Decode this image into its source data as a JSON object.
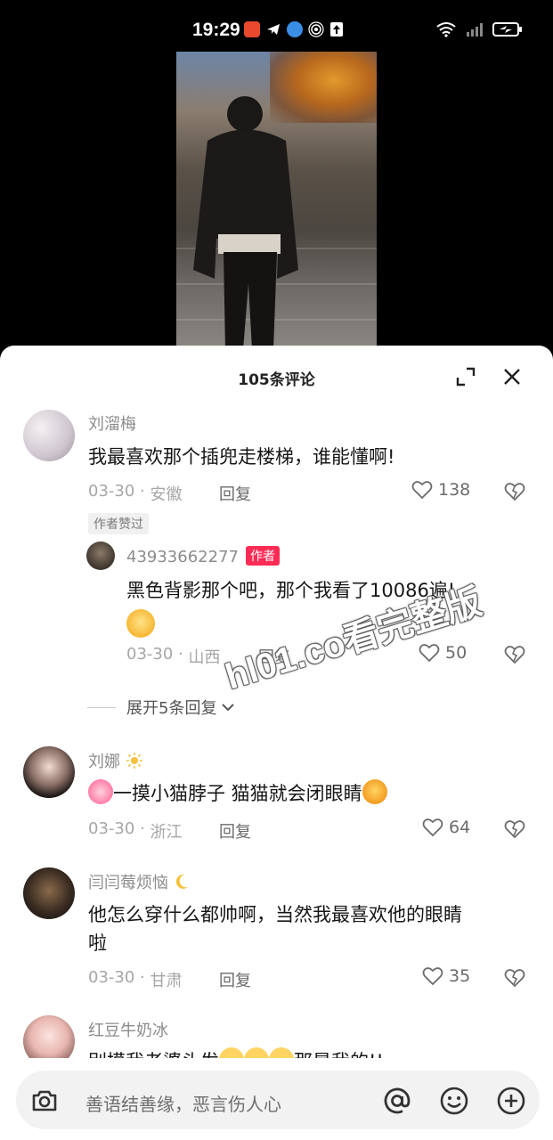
{
  "status_bar": {
    "time": "19:29"
  },
  "sheet": {
    "title": "105条评论"
  },
  "comments": [
    {
      "name": "刘溜梅",
      "text": "我最喜欢那个插兜走楼梯，谁能懂啊!",
      "date": "03-30",
      "location": "安徽",
      "reply_label": "回复",
      "likes": "138",
      "tag": "作者赞过"
    },
    {
      "name": "43933662277",
      "badge": "作者",
      "text": "黑色背影那个吧，那个我看了10086遍!",
      "date": "03-30",
      "location": "山西",
      "reply_label": "回复",
      "likes": "50"
    },
    {
      "name": "刘娜",
      "text": "一摸小猫脖子 猫猫就会闭眼睛",
      "date": "03-30",
      "location": "浙江",
      "reply_label": "回复",
      "likes": "64"
    },
    {
      "name": "闫闫莓烦恼",
      "text": "他怎么穿什么都帅啊，当然我最喜欢他的眼睛",
      "text_line2": "啦",
      "date": "03-30",
      "location": "甘肃",
      "reply_label": "回复",
      "likes": "35"
    },
    {
      "name": "红豆牛奶冰",
      "text_start": "别摸我老婆头发",
      "text_end": "那是我的!!"
    }
  ],
  "expand_replies": "展开5条回复",
  "input": {
    "placeholder": "善语结善缘，恶言伤人心"
  },
  "watermark": "hl01.co看完整版",
  "colors": {
    "author_badge": "#fe2c55",
    "sheet_bg": "#ffffff",
    "input_bg": "#f2f2f2"
  }
}
